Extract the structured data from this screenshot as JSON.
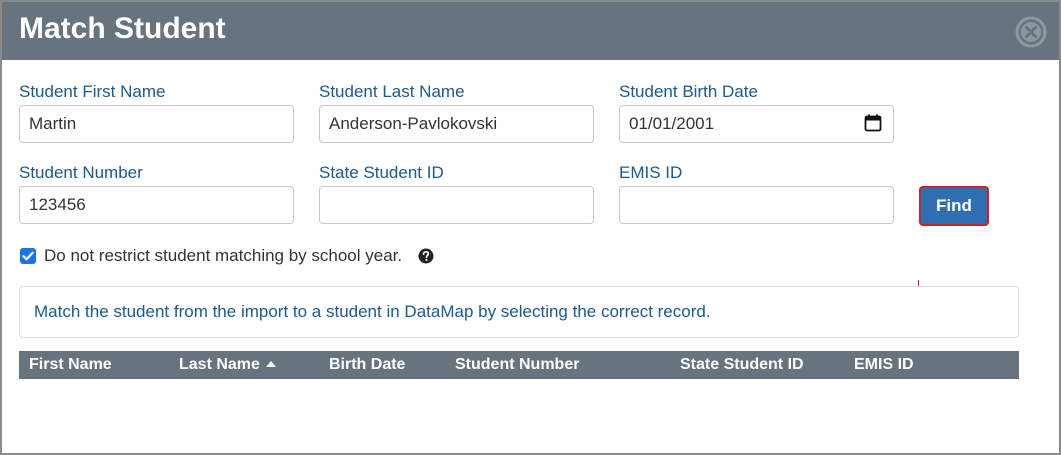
{
  "dialog": {
    "title": "Match Student"
  },
  "form": {
    "first_name": {
      "label": "Student First Name",
      "value": "Martin"
    },
    "last_name": {
      "label": "Student Last Name",
      "value": "Anderson-Pavlokovski"
    },
    "birth_date": {
      "label": "Student Birth Date",
      "value": "01/01/2001"
    },
    "student_number": {
      "label": "Student Number",
      "value": "123456"
    },
    "state_student_id": {
      "label": "State Student ID",
      "value": ""
    },
    "emis_id": {
      "label": "EMIS ID",
      "value": ""
    },
    "find_label": "Find",
    "restrict_checkbox": {
      "label": "Do not restrict student matching by school year.",
      "checked": true
    }
  },
  "info": {
    "message": "Match the student from the import to a student in DataMap by selecting the correct record."
  },
  "table": {
    "columns": [
      "First Name",
      "Last Name",
      "Birth Date",
      "Student Number",
      "State Student ID",
      "EMIS ID"
    ],
    "sorted_column": "Last Name",
    "sort_direction": "ascending"
  },
  "colors": {
    "header_bg": "#67737d",
    "label_text": "#1a5a8f",
    "find_button_bg": "#2e6fb2",
    "find_button_border": "#d1202a"
  }
}
